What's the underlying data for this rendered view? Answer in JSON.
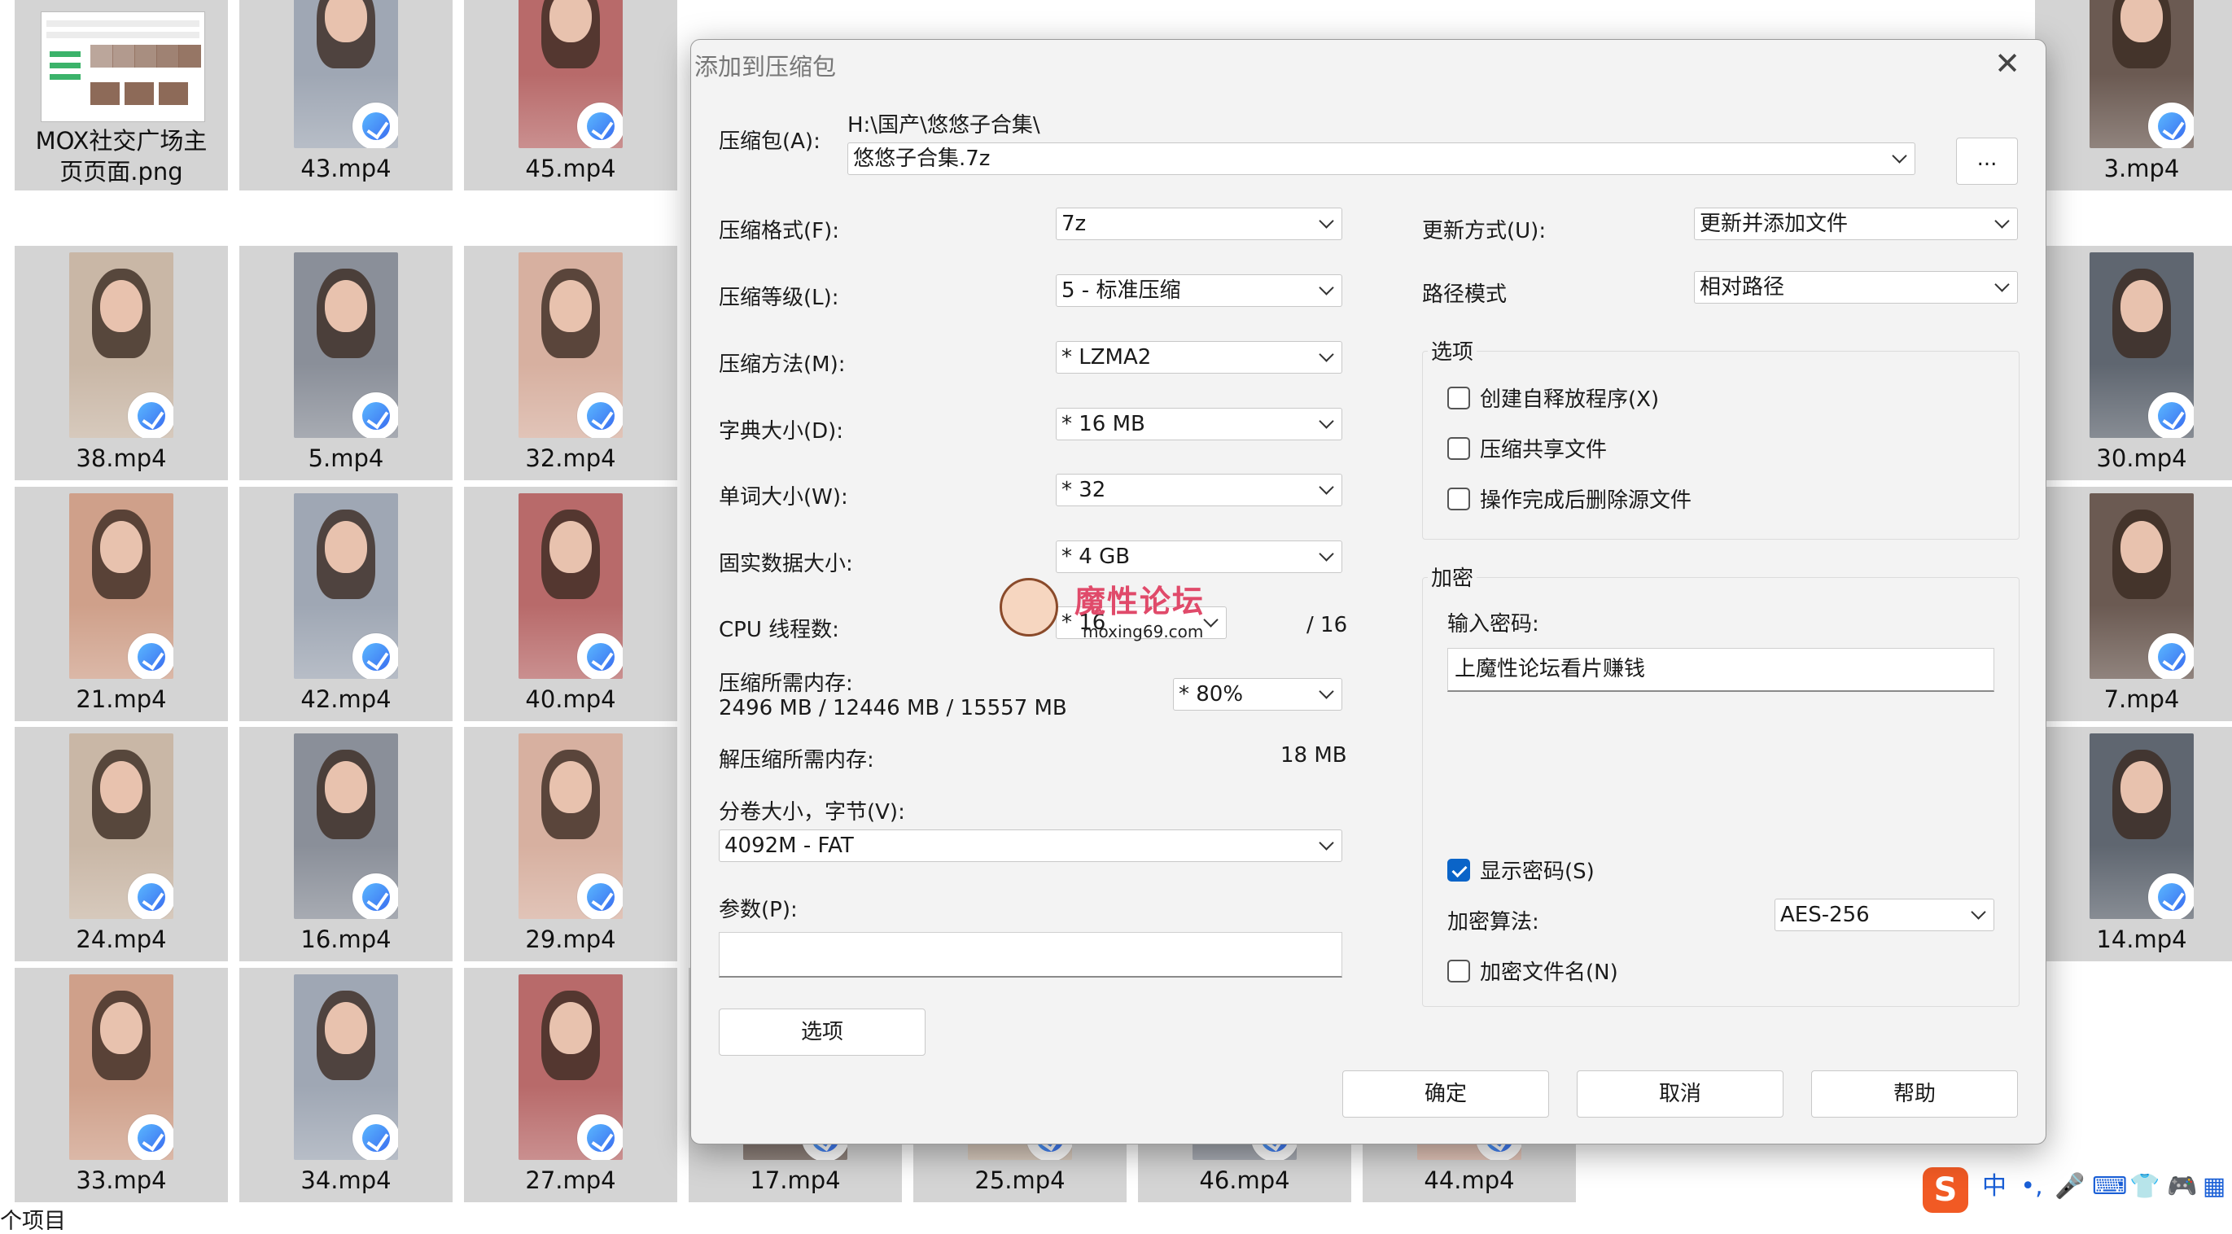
{
  "files": [
    {
      "name": "MOX社交广场主\n页页面.png",
      "kind": "image"
    },
    {
      "name": "43.mp4",
      "kind": "video"
    },
    {
      "name": "45.mp4",
      "kind": "video"
    },
    {
      "name": "3.mp4",
      "kind": "video"
    },
    {
      "name": "38.mp4",
      "kind": "video"
    },
    {
      "name": "5.mp4",
      "kind": "video"
    },
    {
      "name": "32.mp4",
      "kind": "video"
    },
    {
      "name": "30.mp4",
      "kind": "video"
    },
    {
      "name": "21.mp4",
      "kind": "video"
    },
    {
      "name": "42.mp4",
      "kind": "video"
    },
    {
      "name": "40.mp4",
      "kind": "video"
    },
    {
      "name": "7.mp4",
      "kind": "video"
    },
    {
      "name": "24.mp4",
      "kind": "video"
    },
    {
      "name": "16.mp4",
      "kind": "video"
    },
    {
      "name": "29.mp4",
      "kind": "video"
    },
    {
      "name": "14.mp4",
      "kind": "video"
    },
    {
      "name": "33.mp4",
      "kind": "video"
    },
    {
      "name": "34.mp4",
      "kind": "video"
    },
    {
      "name": "27.mp4",
      "kind": "video"
    },
    {
      "name": "17.mp4",
      "kind": "video"
    },
    {
      "name": "25.mp4",
      "kind": "video"
    },
    {
      "name": "46.mp4",
      "kind": "video"
    },
    {
      "name": "44.mp4",
      "kind": "video"
    }
  ],
  "status": {
    "items_text": "个项目"
  },
  "ime": {
    "logo": "S",
    "lang": "中",
    "punct": "•,",
    "mic_icon": "mic-icon",
    "keyboard_icon": "keyboard-icon",
    "skin_icon": "shirt-icon",
    "game_icon": "gamepad-icon",
    "menu_icon": "grid-icon"
  },
  "dialog": {
    "title": "添加到压缩包",
    "close": "✕",
    "archive_label": "压缩包(A):",
    "archive_path": "H:\\国产\\悠悠子合集\\",
    "archive_name": "悠悠子合集.7z",
    "browse": "...",
    "left": {
      "format_label": "压缩格式(F):",
      "format": "7z",
      "level_label": "压缩等级(L):",
      "level": "5 - 标准压缩",
      "method_label": "压缩方法(M):",
      "method": "*  LZMA2",
      "dict_label": "字典大小(D):",
      "dict": "*  16 MB",
      "word_label": "单词大小(W):",
      "word": "*  32",
      "solid_label": "固实数据大小:",
      "solid": "*  4 GB",
      "cpu_label": "CPU 线程数:",
      "cpu": "*  16",
      "cpu_total": "/ 16",
      "mem_label": "压缩所需内存:",
      "mem_value": "2496 MB / 12446 MB / 15557 MB",
      "mem_pct": "* 80%",
      "decomp_label": "解压缩所需内存:",
      "decomp_value": "18 MB",
      "volume_label": "分卷大小，字节(V):",
      "volume": "4092M - FAT",
      "params_label": "参数(P):",
      "params": "",
      "options_button": "选项"
    },
    "right": {
      "update_label": "更新方式(U):",
      "update": "更新并添加文件",
      "pathmode_label": "路径模式",
      "pathmode": "相对路径",
      "options_group": "选项",
      "opt_sfx": "创建自释放程序(X)",
      "opt_shared": "压缩共享文件",
      "opt_delete": "操作完成后删除源文件",
      "enc_group": "加密",
      "pw_label": "输入密码:",
      "pw_value": "上魔性论坛看片赚钱",
      "show_pw": "显示密码(S)",
      "enc_method_label": "加密算法:",
      "enc_method": "AES-256",
      "enc_names": "加密文件名(N)"
    },
    "buttons": {
      "ok": "确定",
      "cancel": "取消",
      "help": "帮助"
    },
    "watermark": {
      "title": "魔性论坛",
      "url": "moxing69.com"
    }
  }
}
